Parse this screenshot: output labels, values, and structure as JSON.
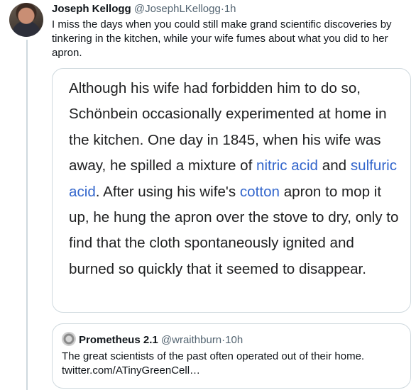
{
  "tweet": {
    "author_name": "Joseph Kellogg",
    "author_handle": "@JosephLKellogg",
    "separator": "·",
    "time": "1h",
    "text": "I miss the days when you could still make grand scientific discoveries by tinkering in the kitchen, while your wife fumes about what you did to her apron."
  },
  "card": {
    "seg1": "Although his wife had forbidden him to do so, Schönbein occasionally experimented at home in the kitchen. One day in 1845, when his wife was away, he spilled a mixture of ",
    "link_nitric": "nitric acid",
    "seg2": " and ",
    "link_sulfuric": "sulfuric acid",
    "seg3": ". After using his wife's ",
    "link_cotton": "cotton",
    "seg4": " apron to mop it up, he hung the apron over the stove to dry, only to find that the cloth spontaneously ignited and burned so quickly that it seemed to disappear."
  },
  "quoted_tweet": {
    "author_name": "Prometheus 2.1",
    "author_handle": "@wraithburn",
    "separator": "·",
    "time": "10h",
    "text": "The great scientists of the past often operated out of their home.",
    "link": "twitter.com/ATinyGreenCell…"
  },
  "colors": {
    "link": "#3366cc",
    "secondary_text": "#536471",
    "border": "#cfd9de"
  }
}
